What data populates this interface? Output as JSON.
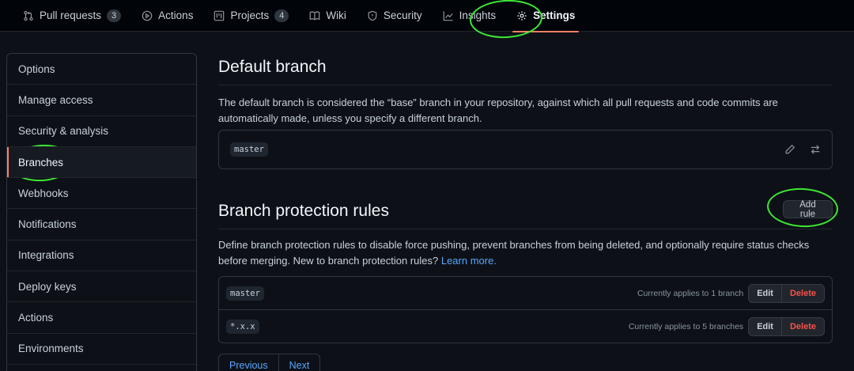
{
  "tabs": [
    {
      "label": "Pull requests",
      "count": "3",
      "icon": "git-pull-request-icon"
    },
    {
      "label": "Actions",
      "icon": "play-icon"
    },
    {
      "label": "Projects",
      "count": "4",
      "icon": "project-icon"
    },
    {
      "label": "Wiki",
      "icon": "book-icon"
    },
    {
      "label": "Security",
      "icon": "shield-icon"
    },
    {
      "label": "Insights",
      "icon": "graph-icon"
    },
    {
      "label": "Settings",
      "icon": "gear-icon",
      "selected": true
    }
  ],
  "sidebar": {
    "items": [
      {
        "label": "Options"
      },
      {
        "label": "Manage access"
      },
      {
        "label": "Security & analysis"
      },
      {
        "label": "Branches",
        "active": true
      },
      {
        "label": "Webhooks"
      },
      {
        "label": "Notifications"
      },
      {
        "label": "Integrations"
      },
      {
        "label": "Deploy keys"
      },
      {
        "label": "Actions"
      },
      {
        "label": "Environments"
      }
    ]
  },
  "default_branch": {
    "title": "Default branch",
    "description": "The default branch is considered the “base” branch in your repository, against which all pull requests and code commits are automatically made, unless you specify a different branch.",
    "branch": "master",
    "edit_icon": "pencil-icon",
    "switch_icon": "arrow-switch-icon"
  },
  "protection": {
    "title": "Branch protection rules",
    "add_rule_label": "Add rule",
    "description": "Define branch protection rules to disable force pushing, prevent branches from being deleted, and optionally require status checks before merging. New to branch protection rules?",
    "learn_more": "Learn more.",
    "rules": [
      {
        "pattern": "master",
        "applies": "Currently applies to 1 branch",
        "edit": "Edit",
        "delete": "Delete"
      },
      {
        "pattern": "*.x.x",
        "applies": "Currently applies to 5 branches",
        "edit": "Edit",
        "delete": "Delete"
      }
    ]
  },
  "pagination": {
    "previous": "Previous",
    "next": "Next"
  },
  "colors": {
    "accent": "#f78166",
    "link": "#58a6ff",
    "danger": "#f85149",
    "annotation": "#3ee636"
  }
}
